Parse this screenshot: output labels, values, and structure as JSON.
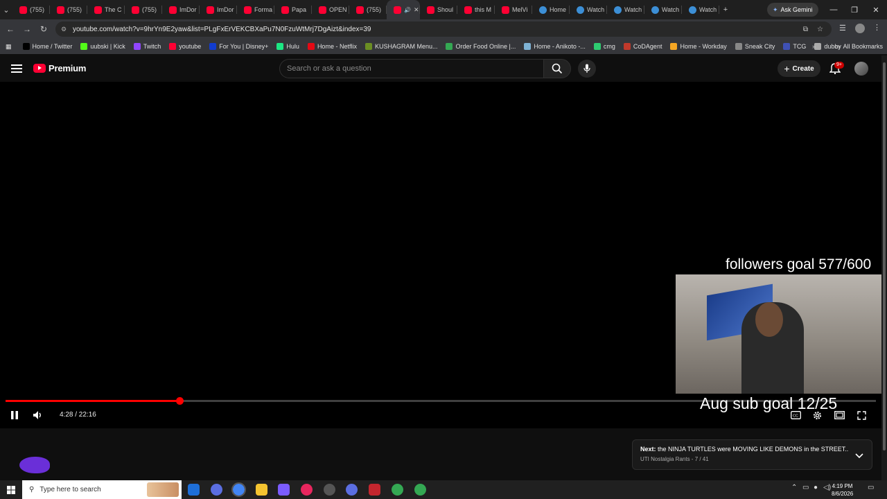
{
  "browser": {
    "tabs": [
      {
        "label": "(755)",
        "icon": "youtube"
      },
      {
        "label": "(755)",
        "icon": "youtube"
      },
      {
        "label": "The C",
        "icon": "youtube"
      },
      {
        "label": "(755)",
        "icon": "youtube"
      },
      {
        "label": "ImDor",
        "icon": "youtube"
      },
      {
        "label": "ImDor",
        "icon": "youtube"
      },
      {
        "label": "Forma",
        "icon": "youtube"
      },
      {
        "label": "Papa",
        "icon": "youtube"
      },
      {
        "label": "OPEN",
        "icon": "youtube"
      },
      {
        "label": "(755)",
        "icon": "youtube"
      },
      {
        "label": "",
        "icon": "youtube-audio"
      },
      {
        "label": "Shoul",
        "icon": "youtube"
      },
      {
        "label": "this M",
        "icon": "youtube"
      },
      {
        "label": "MelVi",
        "icon": "youtube"
      },
      {
        "label": "Home",
        "icon": "chrome-site"
      },
      {
        "label": "Watch",
        "icon": "chrome-site"
      },
      {
        "label": "Watch",
        "icon": "chrome-site"
      },
      {
        "label": "Watch",
        "icon": "chrome-site"
      },
      {
        "label": "Watch",
        "icon": "chrome-site"
      }
    ],
    "new_tab": "+",
    "ask_gemini": "Ask Gemini",
    "url": "youtube.com/watch?v=9hrYn9E2yaw&list=PLgFxErVEKCBXaPu7N0FzuWtMrj7DgAizt&index=39",
    "bookmarks": [
      {
        "label": "Home / Twitter",
        "color": "#000000"
      },
      {
        "label": "uubski | Kick",
        "color": "#53fc18"
      },
      {
        "label": "Twitch",
        "color": "#9146ff"
      },
      {
        "label": "youtube",
        "color": "#ff0033"
      },
      {
        "label": "For You | Disney+",
        "color": "#113ccf"
      },
      {
        "label": "Hulu",
        "color": "#1ce783"
      },
      {
        "label": "Home - Netflix",
        "color": "#e50914"
      },
      {
        "label": "KUSHAGRAM Menu...",
        "color": "#6b8e23"
      },
      {
        "label": "Order Food Online |...",
        "color": "#34a853"
      },
      {
        "label": "Home - Anikoto -...",
        "color": "#7fb3d5"
      },
      {
        "label": "cmg",
        "color": "#2ecc71"
      },
      {
        "label": "CoDAgent",
        "color": "#c0392b"
      },
      {
        "label": "Home - Workday",
        "color": "#f5a623"
      },
      {
        "label": "Sneak City",
        "color": "#888888"
      },
      {
        "label": "TCG",
        "color": "#3f51b5"
      },
      {
        "label": "dubby",
        "color": "#aaaaaa"
      }
    ],
    "all_bookmarks": "All Bookmarks"
  },
  "youtube": {
    "logo_text": "Premium",
    "search_placeholder": "Search or ask a question",
    "create_label": "Create",
    "notification_badge": "9+"
  },
  "player": {
    "overlay_top": "followers goal 577/600",
    "overlay_bottom": "Aug sub goal 12/25",
    "current_time": "4:28",
    "duration": "22:16",
    "time_display": "4:28 / 22:16",
    "progress_fraction": 0.2006
  },
  "next_card": {
    "label": "Next:",
    "title": "the NINJA TURTLES were MOVING LIKE DEMONS in the STREET...",
    "subtitle": "UTI Nostalgia Rants - 7 / 41"
  },
  "taskbar": {
    "search_placeholder": "Type here to search",
    "time": "4:19 PM",
    "date": "8/6/2026"
  },
  "colors": {
    "youtube_red": "#ff0033",
    "progress_red": "#ff0000",
    "background": "#0f0f0f"
  }
}
